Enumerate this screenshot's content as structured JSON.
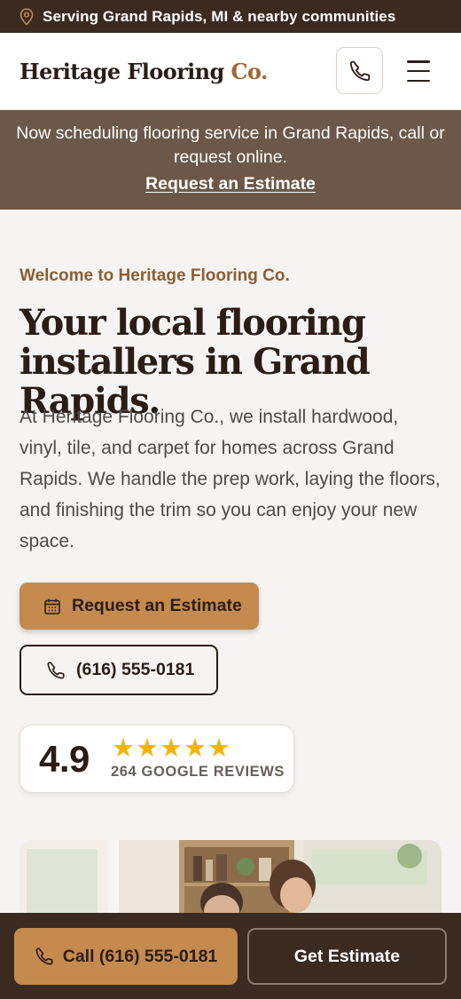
{
  "topbar": {
    "text": "Serving Grand Rapids, MI & nearby communities",
    "icon": "map-pin-icon"
  },
  "header": {
    "brand_main": "Heritage Flooring",
    "brand_suffix": "Co.",
    "phone_icon": "phone-icon",
    "menu_icon": "hamburger-menu-icon"
  },
  "notice": {
    "message": "Now scheduling flooring service in Grand Rapids, call or request online.",
    "link": "Request an Estimate"
  },
  "hero": {
    "eyebrow": "Welcome to Heritage Flooring Co.",
    "title": "Your local flooring installers in Grand Rapids.",
    "body": "At Heritage Flooring Co., we install hardwood, vinyl, tile, and carpet for homes across Grand Rapids. We handle the prep work, laying the floors, and finishing the trim so you can enjoy your new space.",
    "primary_button": "Request an Estimate",
    "primary_icon": "calendar-icon",
    "secondary_button": "(616) 555-0181",
    "secondary_icon": "phone-icon"
  },
  "rating": {
    "score": "4.9",
    "stars": 5,
    "count_label": "264 GOOGLE REVIEWS"
  },
  "cta_bar": {
    "call_label": "Call (616) 555-0181",
    "estimate_label": "Get Estimate"
  },
  "colors": {
    "dark_brown": "#3a2a20",
    "accent": "#c48a4e",
    "notice_bg": "#6b5848",
    "star": "#f5b400",
    "eyebrow": "#8b5e33"
  }
}
